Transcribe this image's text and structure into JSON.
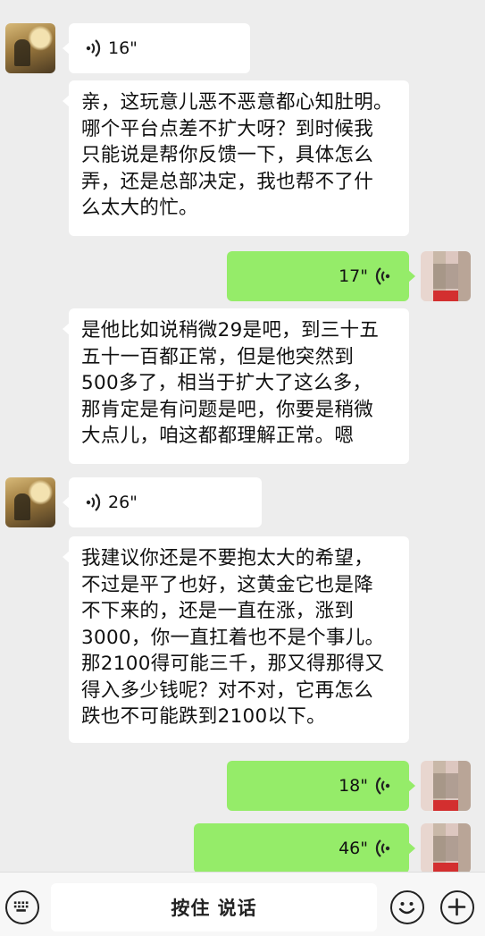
{
  "messages": [
    {
      "type": "voice_in",
      "duration": "16\""
    },
    {
      "type": "text_in",
      "text": "亲，这玩意儿恶不恶意都心知肚明。\n哪个平台点差不扩大呀？到时候我\n只能说是帮你反馈一下，具体怎么\n弄，还是总部决定，我也帮不了什\n么太大的忙。"
    },
    {
      "type": "voice_out",
      "duration": "17\""
    },
    {
      "type": "text_in",
      "text": "是他比如说稍微29是吧，到三十五\n五十一百都正常，但是他突然到\n500多了，相当于扩大了这么多，\n那肯定是有问题是吧，你要是稍微\n大点儿，咱这都都理解正常。嗯"
    },
    {
      "type": "voice_in",
      "duration": "26\""
    },
    {
      "type": "text_in",
      "text": "我建议你还是不要抱太大的希望，\n不过是平了也好，这黄金它也是降\n不下来的，还是一直在涨，涨到\n3000，你一直扛着也不是个事儿。\n那2100得可能三千，那又得那得又\n得入多少钱呢？对不对，它再怎么\n跌也不可能跌到2100以下。"
    },
    {
      "type": "voice_out",
      "duration": "18\""
    },
    {
      "type": "voice_out",
      "duration": "46\""
    }
  ],
  "input_bar": {
    "hold_to_talk": "按住 说话",
    "keyboard_icon": "keyboard-icon",
    "emoji_icon": "emoji-icon",
    "plus_icon": "plus-icon"
  },
  "colors": {
    "background": "#ededed",
    "incoming_bubble": "#ffffff",
    "outgoing_bubble": "#95ec69"
  }
}
